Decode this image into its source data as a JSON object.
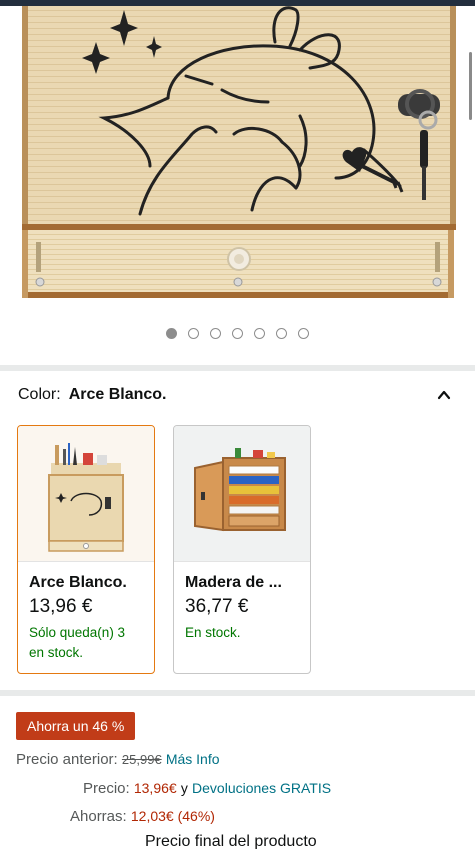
{
  "carousel": {
    "image_alt": "Arce Blanco desk organizer with bunny drawing",
    "dot_count": 7,
    "active_index": 0
  },
  "color": {
    "label": "Color:",
    "selected": "Arce Blanco."
  },
  "variants": [
    {
      "name": "Arce Blanco.",
      "price": "13,96 €",
      "stock": "Sólo queda(n) 3 en stock.",
      "selected": true
    },
    {
      "name": "Madera de ...",
      "price": "36,77 €",
      "stock": "En stock.",
      "selected": false
    }
  ],
  "savings_badge": "Ahorra un 46 %",
  "pricing": {
    "previous_label": "Precio anterior:",
    "previous_value": "25,99€",
    "more_info": "Más Info",
    "price_label": "Precio:",
    "price_value": "13,96€",
    "and_text": "y",
    "returns_link": "Devoluciones GRATIS",
    "savings_label": "Ahorras:",
    "savings_value": "12,03€ (46%)",
    "final_price_label": "Precio final del producto"
  },
  "colors": {
    "accent_orange": "#e47911",
    "badge_red": "#c13c18",
    "price_red": "#b12704",
    "stock_green": "#007600",
    "link_teal": "#007185"
  }
}
